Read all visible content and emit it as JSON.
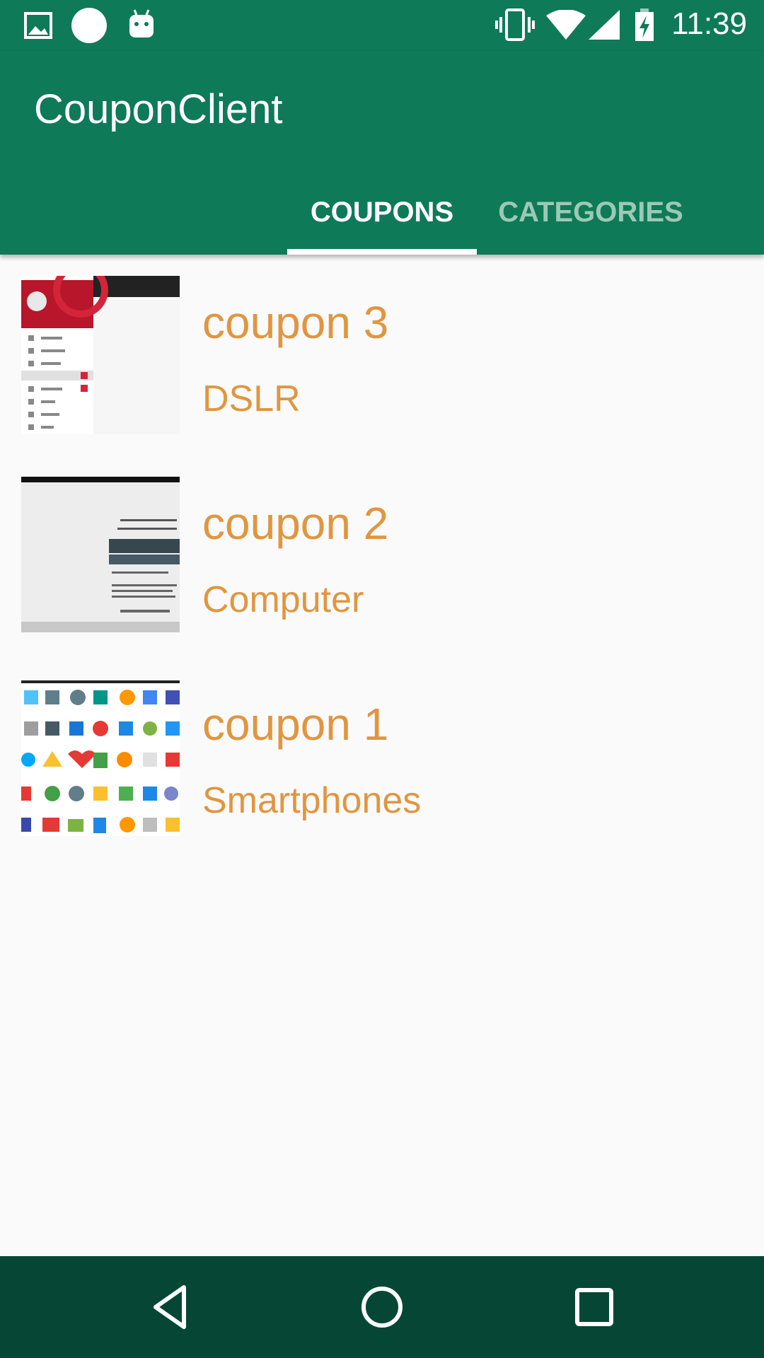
{
  "status_bar": {
    "time": "11:39",
    "icons": [
      "image-icon",
      "circle-icon",
      "android-icon",
      "vibrate-icon",
      "wifi-icon",
      "signal-icon",
      "battery-charging-icon"
    ]
  },
  "app_bar": {
    "title": "CouponClient",
    "tabs": [
      {
        "label": "COUPONS",
        "selected": true
      },
      {
        "label": "CATEGORIES",
        "selected": false
      }
    ]
  },
  "coupons": [
    {
      "title": "coupon 3",
      "category": "DSLR",
      "thumbnail": "app-drawer-screenshot"
    },
    {
      "title": "coupon 2",
      "category": "Computer",
      "thumbnail": "dialog-screenshot"
    },
    {
      "title": "coupon 1",
      "category": "Smartphones",
      "thumbnail": "app-icons-grid-screenshot"
    }
  ],
  "colors": {
    "primary": "#0f7a57",
    "nav_bar": "#054734",
    "accent_text": "#e09640",
    "background": "#fafafa"
  },
  "nav_bar": {
    "buttons": [
      "back-icon",
      "home-icon",
      "recents-icon"
    ]
  }
}
